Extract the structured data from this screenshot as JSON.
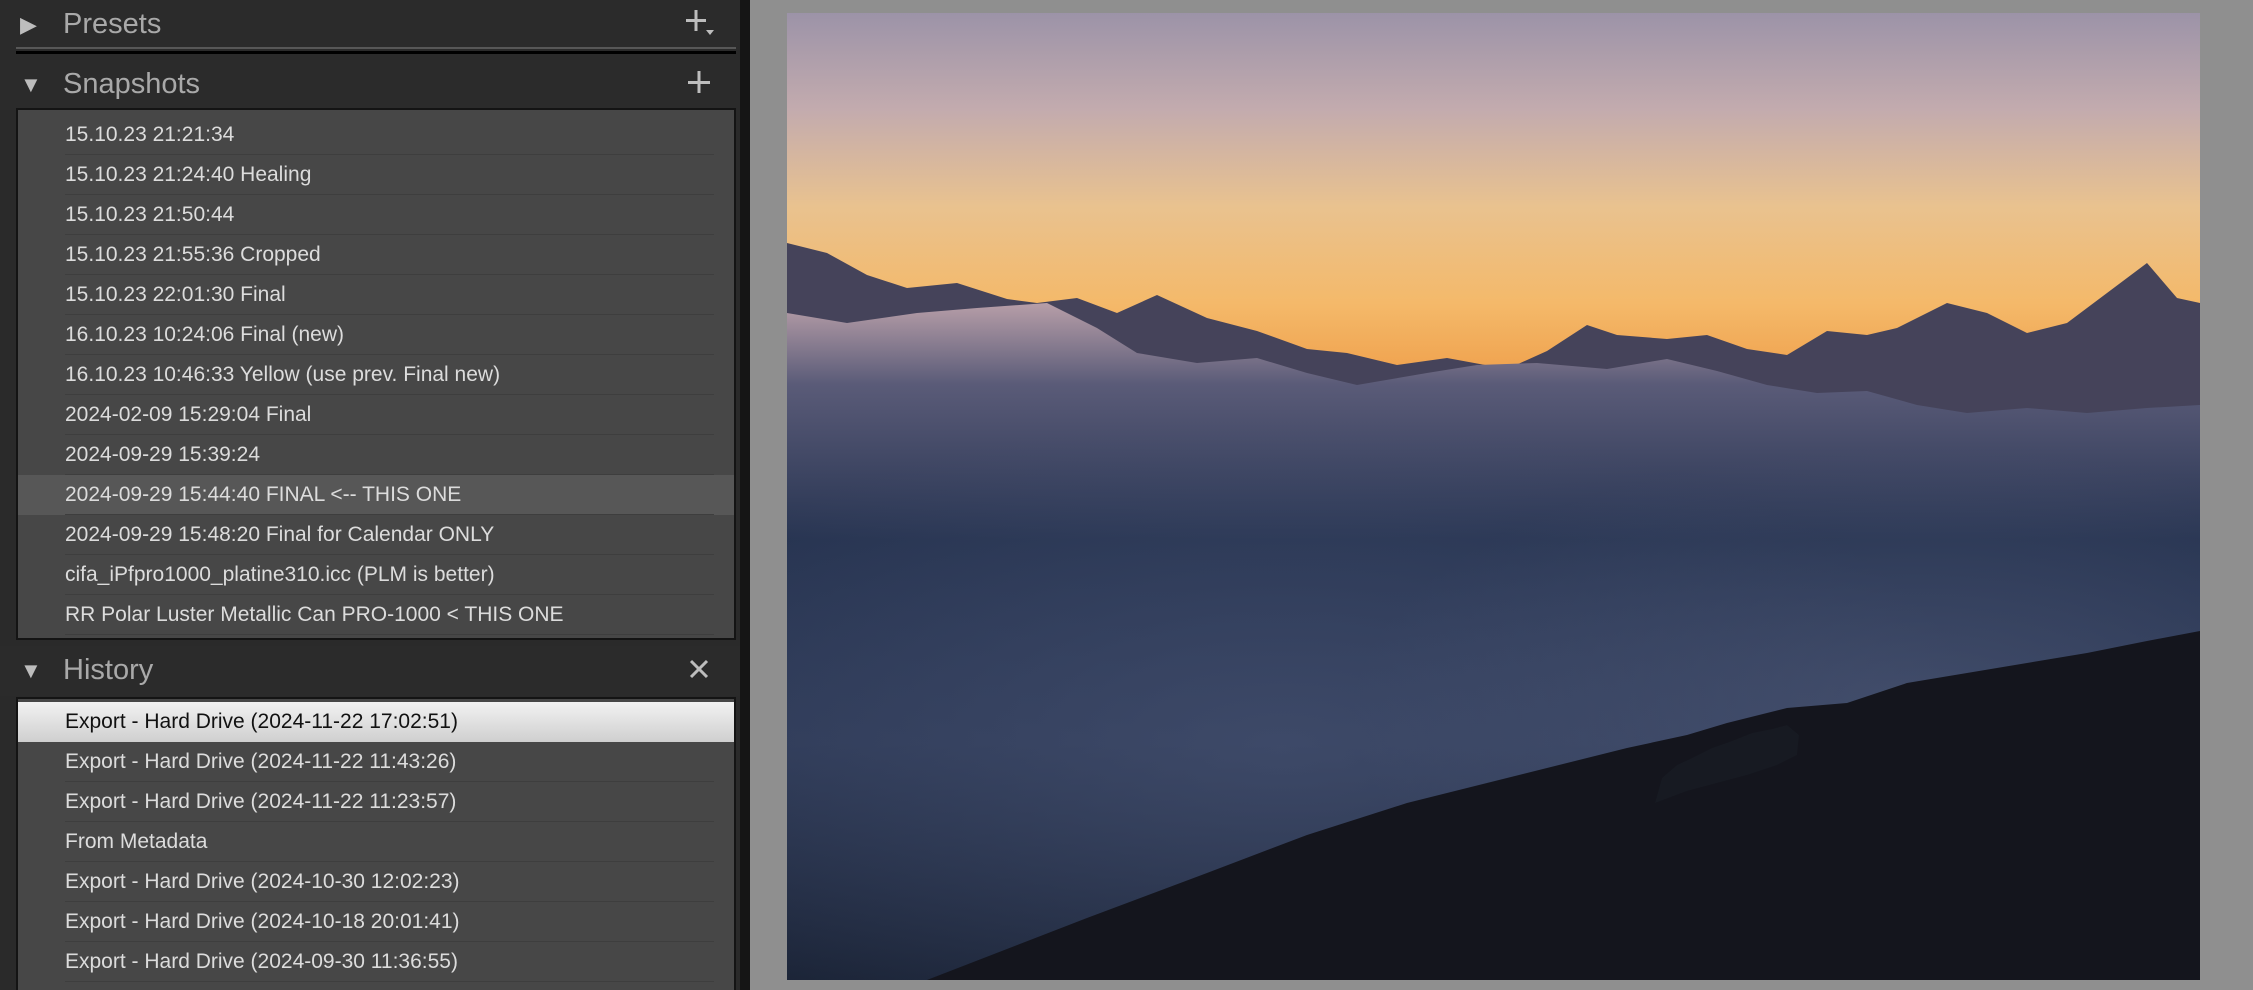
{
  "presets": {
    "title": "Presets",
    "add_icon": "plus-dropdown-icon"
  },
  "snapshots": {
    "title": "Snapshots",
    "add_icon": "plus-icon",
    "items": [
      {
        "label": "15.10.23 21:21:34"
      },
      {
        "label": "15.10.23 21:24:40 Healing"
      },
      {
        "label": "15.10.23 21:50:44"
      },
      {
        "label": "15.10.23 21:55:36 Cropped"
      },
      {
        "label": "15.10.23 22:01:30 Final"
      },
      {
        "label": "16.10.23 10:24:06 Final (new)"
      },
      {
        "label": "16.10.23 10:46:33 Yellow (use prev. Final new)"
      },
      {
        "label": "2024-02-09 15:29:04 Final"
      },
      {
        "label": "2024-09-29 15:39:24"
      },
      {
        "label": "2024-09-29 15:44:40 FINAL <-- THIS ONE"
      },
      {
        "label": "2024-09-29 15:48:20 Final for Calendar ONLY"
      },
      {
        "label": "cifa_iPfpro1000_platine310.icc (PLM is better)"
      },
      {
        "label": "RR Polar Luster Metallic Can PRO-1000 < THIS ONE"
      }
    ]
  },
  "history": {
    "title": "History",
    "clear_icon": "close-icon",
    "items": [
      {
        "label": "Export - Hard Drive (2024-11-22 17:02:51)"
      },
      {
        "label": "Export - Hard Drive (2024-11-22 11:43:26)"
      },
      {
        "label": "Export - Hard Drive (2024-11-22 11:23:57)"
      },
      {
        "label": "From Metadata"
      },
      {
        "label": "Export - Hard Drive (2024-10-30 12:02:23)"
      },
      {
        "label": "Export - Hard Drive (2024-10-18 20:01:41)"
      },
      {
        "label": "Export - Hard Drive (2024-09-30 11:36:55)"
      }
    ]
  },
  "preview": {
    "image_subject": "mountain-sunset-above-clouds-photo"
  },
  "colors": {
    "panel_bg": "#2a2a2a",
    "list_bg": "#474747",
    "selected_row": "#e6e6e6",
    "preview_bg": "#8f8f8f"
  }
}
